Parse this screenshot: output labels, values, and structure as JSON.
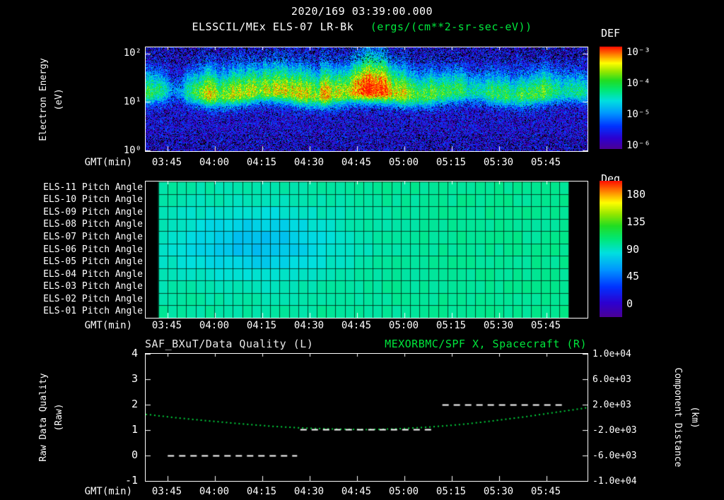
{
  "header": {
    "datetime": "2020/169 03:39:00.000"
  },
  "energy_panel": {
    "title": "ELSSCIL/MEx ELS-07 LR-Bk",
    "units": "(ergs/(cm**2-sr-sec-eV))",
    "ylabel_line1": "Electron Energy",
    "ylabel_line2": "(eV)",
    "ytick_labels": [
      "10²",
      "10¹",
      "10⁰"
    ],
    "colorbar_title": "DEF",
    "colorbar_ticks": [
      "10⁻³",
      "10⁻⁴",
      "10⁻⁵",
      "10⁻⁶"
    ]
  },
  "pitch_panel": {
    "row_labels": [
      "ELS-11 Pitch Angle",
      "ELS-10 Pitch Angle",
      "ELS-09 Pitch Angle",
      "ELS-08 Pitch Angle",
      "ELS-07 Pitch Angle",
      "ELS-06 Pitch Angle",
      "ELS-05 Pitch Angle",
      "ELS-04 Pitch Angle",
      "ELS-03 Pitch Angle",
      "ELS-02 Pitch Angle",
      "ELS-01 Pitch Angle"
    ],
    "colorbar_title": "Deg",
    "colorbar_ticks": [
      "180",
      "135",
      "90",
      "45",
      "0"
    ]
  },
  "quality_panel": {
    "title_left": "SAF_BXuT/Data Quality (L)",
    "title_right": "MEXORBMC/SPF X, Spacecraft (R)",
    "ylabel_left_line1": "Raw Data Quality",
    "ylabel_left_line2": "(Raw)",
    "ylabel_right_line1": "Component Distance",
    "ylabel_right_line2": "(km)",
    "ytick_labels_left": [
      "4",
      "3",
      "2",
      "1",
      "0",
      "-1"
    ],
    "ytick_labels_right": [
      "1.0e+04",
      "6.0e+03",
      "2.0e+03",
      "-2.0e+03",
      "-6.0e+03",
      "-1.0e+04"
    ]
  },
  "xaxis": {
    "label": "GMT(min)",
    "tick_labels": [
      "03:45",
      "04:00",
      "04:15",
      "04:30",
      "04:45",
      "05:00",
      "05:15",
      "05:30",
      "05:45"
    ],
    "tick_minutes": [
      7,
      22,
      37,
      52,
      67,
      82,
      97,
      112,
      127
    ],
    "start_time": "03:38",
    "span_minutes": 140
  },
  "colors": {
    "background": "#000000",
    "text": "#ffffff",
    "accent_green": "#00e63c",
    "axis": "#ffffff"
  },
  "chart_data": [
    {
      "type": "heatmap",
      "name": "electron-energy-spectrogram",
      "title": "ELSSCIL/MEx ELS-07 LR-Bk",
      "units": "ergs/(cm**2-sr-sec-eV)",
      "x_axis": "GMT minutes after 03:38, span 140 min (03:38-05:58)",
      "y_axis": "log10 electron energy (eV)",
      "y_log_range": [
        0,
        2.13
      ],
      "flux_log10_range": [
        -6,
        -3
      ],
      "band_center_log_ev": 1.18,
      "band_envelope_minutes": [
        0,
        5,
        8,
        11,
        14,
        18,
        22,
        26,
        30,
        34,
        38,
        42,
        46,
        50,
        54,
        58,
        62,
        66,
        70,
        73,
        76,
        80,
        84,
        88,
        92,
        96,
        100,
        103,
        106,
        110,
        114,
        118,
        122,
        125,
        128,
        132,
        136,
        140
      ],
      "band_envelope_strength": [
        0.5,
        0.47,
        0.2,
        0.25,
        0.45,
        0.6,
        0.66,
        0.62,
        0.66,
        0.7,
        0.64,
        0.68,
        0.72,
        0.66,
        0.7,
        0.74,
        0.7,
        0.78,
        0.88,
        0.92,
        0.8,
        0.66,
        0.58,
        0.55,
        0.52,
        0.5,
        0.52,
        0.34,
        0.42,
        0.52,
        0.5,
        0.46,
        0.44,
        0.58,
        0.5,
        0.46,
        0.44,
        0.4
      ],
      "colormap_stops": [
        [
          0,
          "#4b0096"
        ],
        [
          0.1,
          "#2e00d0"
        ],
        [
          0.22,
          "#0033ff"
        ],
        [
          0.35,
          "#0099ff"
        ],
        [
          0.47,
          "#00e0e0"
        ],
        [
          0.57,
          "#00e87a"
        ],
        [
          0.67,
          "#22dd22"
        ],
        [
          0.76,
          "#99e800"
        ],
        [
          0.84,
          "#ffff00"
        ],
        [
          0.92,
          "#ff8800"
        ],
        [
          1,
          "#ff1100"
        ]
      ]
    },
    {
      "type": "heatmap",
      "name": "pitch-angle-grid",
      "rows": 11,
      "cols": 44,
      "deg_range": [
        0,
        180
      ],
      "base_deg": 96,
      "cyan_dip": {
        "center_col": 10,
        "center_row": 4.5,
        "depth_deg": 22
      },
      "data_start_minute": 4,
      "data_end_minute": 134
    },
    {
      "type": "line",
      "name": "quality-and-spacecraft-x",
      "left_axis_range": [
        -1,
        4
      ],
      "right_axis_range_km": [
        -10000,
        10000
      ],
      "series": [
        {
          "name": "MEXORBMC/SPF X Spacecraft",
          "axis": "right",
          "style": "dotted",
          "color": "#00d23c",
          "x_minutes": [
            0,
            10,
            20,
            30,
            40,
            50,
            60,
            70,
            80,
            90,
            100,
            110,
            120,
            130,
            140
          ],
          "left_axis_values": [
            1.62,
            1.48,
            1.36,
            1.25,
            1.15,
            1.08,
            1.04,
            1.02,
            1.05,
            1.12,
            1.22,
            1.36,
            1.52,
            1.7,
            1.88
          ],
          "km_values": [
            480,
            -80,
            -560,
            -1000,
            -1400,
            -1680,
            -1840,
            -1920,
            -1800,
            -1520,
            -1120,
            -560,
            80,
            800,
            1520
          ]
        },
        {
          "name": "SAF_BXuT Data Quality",
          "axis": "left",
          "style": "dashed",
          "color": "#ffffff",
          "segments": [
            {
              "x0_min": 7,
              "x1_min": 48,
              "value": 0
            },
            {
              "x0_min": 49,
              "x1_min": 92,
              "value": 1.03
            },
            {
              "x0_min": 94,
              "x1_min": 133,
              "value": 2
            }
          ]
        }
      ]
    }
  ]
}
